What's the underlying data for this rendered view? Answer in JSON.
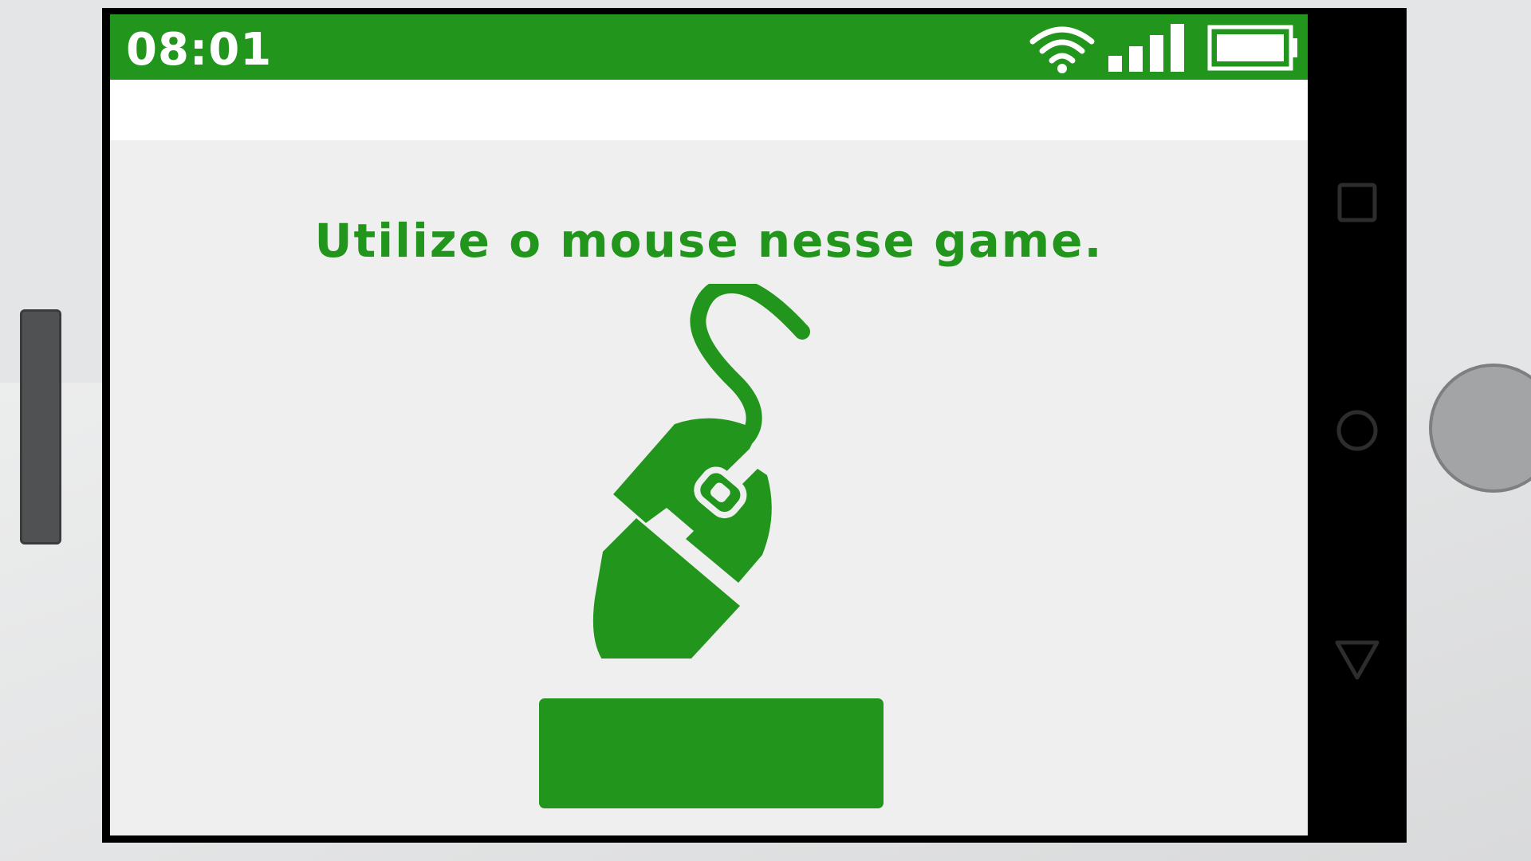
{
  "status_bar": {
    "time": "08:01",
    "icons": [
      "wifi-icon",
      "signal-icon",
      "battery-icon"
    ],
    "color": "#22961c"
  },
  "content": {
    "instruction": "Utilize o mouse nesse game.",
    "illustration": "computer-mouse-icon",
    "start_button_label": ""
  },
  "nav_bar": {
    "buttons": [
      "recent-apps-icon",
      "home-icon",
      "back-icon"
    ]
  },
  "colors": {
    "accent": "#22961c",
    "screen_bg": "#efefef",
    "frame": "#000000"
  }
}
